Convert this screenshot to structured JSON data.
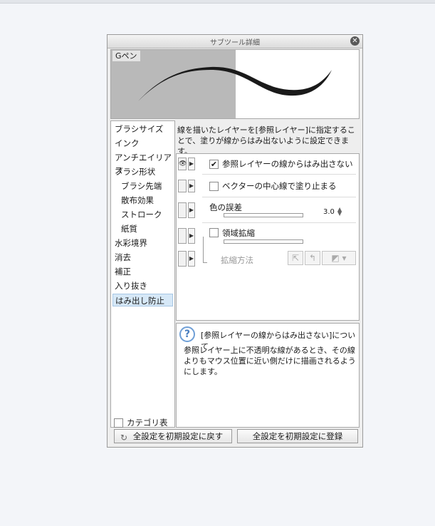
{
  "window": {
    "title": "サブツール詳細",
    "close": "✕"
  },
  "preview": {
    "brush_name": "Gペン"
  },
  "categories": [
    {
      "label": "ブラシサイズ",
      "sub": false
    },
    {
      "label": "インク",
      "sub": false
    },
    {
      "label": "アンチエイリアス",
      "sub": false
    },
    {
      "label": "ブラシ形状",
      "sub": false
    },
    {
      "label": "ブラシ先端",
      "sub": true
    },
    {
      "label": "散布効果",
      "sub": true
    },
    {
      "label": "ストローク",
      "sub": true
    },
    {
      "label": "紙質",
      "sub": true
    },
    {
      "label": "水彩境界",
      "sub": false
    },
    {
      "label": "消去",
      "sub": false
    },
    {
      "label": "補正",
      "sub": false
    },
    {
      "label": "入り抜き",
      "sub": false
    },
    {
      "label": "はみ出し防止",
      "sub": false,
      "selected": true
    }
  ],
  "category_display_label": "カテゴリ表示",
  "description": "線を描いたレイヤーを[参照レイヤー]に指定することで、塗りが線からはみ出ないように設定できます。",
  "settings": {
    "ref_layer_label": "参照レイヤーの線からはみ出さない",
    "ref_layer_checked": true,
    "vector_center_label": "ベクターの中心線で塗り止まる",
    "vector_center_checked": false,
    "color_tolerance_label": "色の誤差",
    "color_tolerance_value": "3.0",
    "area_expand_label": "領域拡縮",
    "area_expand_checked": false,
    "expand_method_label": "拡縮方法"
  },
  "help": {
    "title": "[参照レイヤーの線からはみ出さない]について",
    "body": "参照レイヤー上に不透明な線があるとき、その線よりもマウス位置に近い側だけに描画されるようにします。"
  },
  "buttons": {
    "reset_all": "全設定を初期設定に戻す",
    "register_all": "全設定を初期設定に登録"
  },
  "icons": {
    "eye": "eye-icon",
    "arrow": "triangle-right-icon",
    "help": "question-icon"
  }
}
